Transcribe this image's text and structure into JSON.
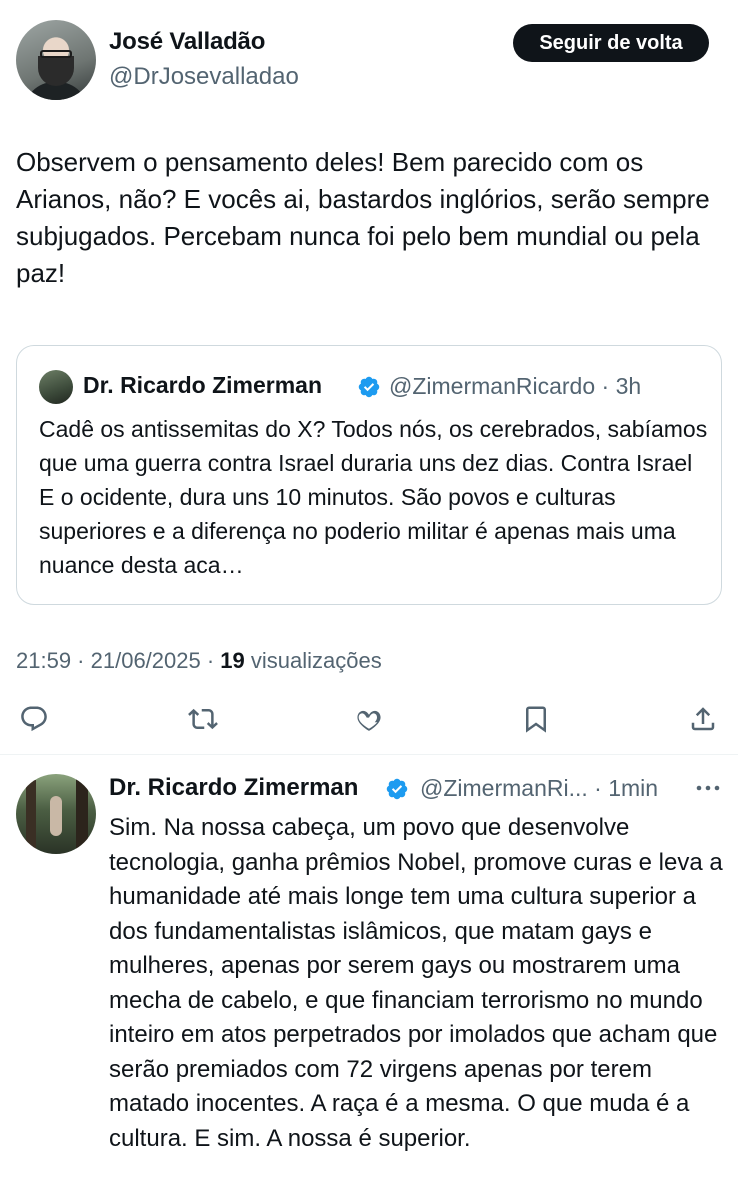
{
  "main_tweet": {
    "author_name": "José Valladão",
    "author_handle": "@DrJosevalladao",
    "follow_button_label": "Seguir de volta",
    "text": "Observem o pensamento deles! Bem parecido com os Arianos, não? E vocês ai, bastardos inglórios, serão sempre subjugados. Percebam nunca foi pelo bem mundial ou pela paz!",
    "time": "21:59",
    "date": "21/06/2025",
    "views_count": "19",
    "views_label": "visualizações"
  },
  "quoted_tweet": {
    "author_name": "Dr. Ricardo Zimerman",
    "author_handle": "@ZimermanRicardo",
    "age": "3h",
    "text": "Cadê os antissemitas do X? Todos nós, os cerebrados, sabíamos que uma guerra contra Israel duraria uns dez dias. Contra Israel E o ocidente, dura uns 10 minutos. São povos e culturas superiores e a diferença no poderio militar é apenas mais uma nuance desta aca…"
  },
  "actions": [
    {
      "icon": "reply-icon"
    },
    {
      "icon": "retweet-icon"
    },
    {
      "icon": "like-icon"
    },
    {
      "icon": "bookmark-icon"
    },
    {
      "icon": "share-icon"
    }
  ],
  "reply": {
    "author_name": "Dr. Ricardo Zimerman",
    "author_handle": "@ZimermanRi...",
    "age": "1min",
    "text": "Sim. Na nossa cabeça, um povo que desenvolve tecnologia, ganha prêmios Nobel, promove curas e leva a humanidade até mais longe tem uma cultura superior a dos fundamentalistas islâmicos, que matam gays e mulheres, apenas por serem gays ou mostrarem uma mecha de cabelo, e que financiam terrorismo no mundo inteiro em atos perpetrados por imolados que acham que serão premiados com 72 virgens apenas por terem matado inocentes. A raça é a mesma. O que muda é a cultura. E sim. A nossa é superior."
  },
  "colors": {
    "text": "#0f1419",
    "secondary": "#536471",
    "verified": "#1d9bf0",
    "border": "#cfd9de"
  }
}
